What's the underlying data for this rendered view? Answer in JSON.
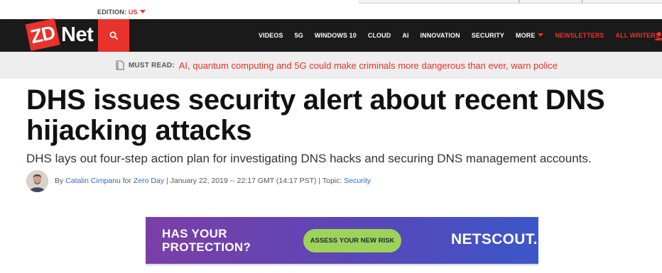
{
  "edition": {
    "prefix": "EDITION:",
    "value": "US"
  },
  "nav": {
    "logo_prefix": "ZD",
    "logo_suffix": "Net",
    "links": [
      {
        "label": "VIDEOS"
      },
      {
        "label": "5G"
      },
      {
        "label": "WINDOWS 10"
      },
      {
        "label": "CLOUD"
      },
      {
        "label": "AI"
      },
      {
        "label": "INNOVATION"
      },
      {
        "label": "SECURITY"
      },
      {
        "label": "MORE"
      },
      {
        "label": "NEWSLETTERS"
      },
      {
        "label": "ALL WRITERS"
      }
    ]
  },
  "must_read": {
    "label": "MUST READ:",
    "link": "AI, quantum computing and 5G could make criminals more dangerous than ever, warn police"
  },
  "article": {
    "headline": "DHS issues security alert about recent DNS hijacking attacks",
    "subhead": "DHS lays out four-step action plan for investigating DNS hacks and securing DNS management accounts.",
    "byline": {
      "by": "By",
      "author": "Catalin Cimpanu",
      "for": "for",
      "blog": "Zero Day",
      "date": "| January 22, 2019 -- 22:17 GMT (14:17 PST) | Topic:",
      "topic": "Security"
    }
  },
  "ad": {
    "line1": "HAS YOUR",
    "line2": "PROTECTION?",
    "cta": "ASSESS YOUR NEW RISK",
    "brand": "NETSCOUT."
  },
  "colors": {
    "brand_red": "#e8322b",
    "nav_bg": "#1a1a1a",
    "link_blue": "#2a6bc2",
    "ad_cta_green": "#9ed35a"
  },
  "icons": [
    "search-icon",
    "user-icon",
    "document-icon",
    "caret-down-icon"
  ]
}
